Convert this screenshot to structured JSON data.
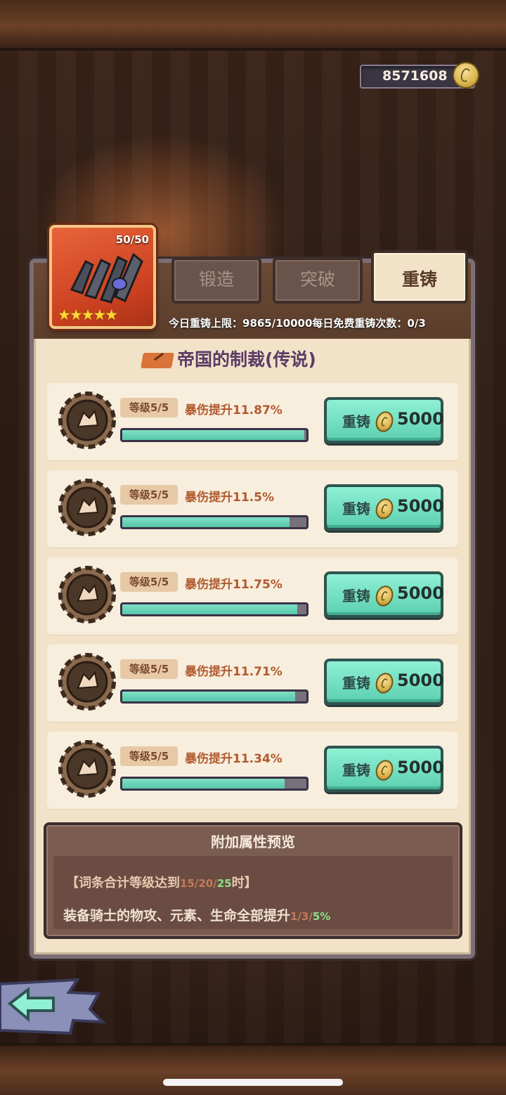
{
  "currency": {
    "amount": "8571608",
    "icon": "gold-coin-icon"
  },
  "item": {
    "level": "50/50",
    "stars": "★★★★★",
    "icon": "iron-claw-gauntlet-icon"
  },
  "tabs": [
    {
      "label": "锻造",
      "active": false
    },
    {
      "label": "突破",
      "active": false
    },
    {
      "label": "重铸",
      "active": true
    }
  ],
  "limits": {
    "text": "今日重铸上限：9865/10000每日免费重铸次数：0/3"
  },
  "set_title": "帝国的制裁(传说)",
  "affixes": [
    {
      "level": "等级5/5",
      "stat": "暴伤提升11.87%",
      "progress": 0.99,
      "button": "重铸",
      "cost": "5000"
    },
    {
      "level": "等级5/5",
      "stat": "暴伤提升11.5%",
      "progress": 0.91,
      "button": "重铸",
      "cost": "5000"
    },
    {
      "level": "等级5/5",
      "stat": "暴伤提升11.75%",
      "progress": 0.95,
      "button": "重铸",
      "cost": "5000"
    },
    {
      "level": "等级5/5",
      "stat": "暴伤提升11.71%",
      "progress": 0.94,
      "button": "重铸",
      "cost": "5000"
    },
    {
      "level": "等级5/5",
      "stat": "暴伤提升11.34%",
      "progress": 0.88,
      "button": "重铸",
      "cost": "5000"
    }
  ],
  "preview": {
    "title": "附加属性预览",
    "line1_prefix": "【词条合计等级达到",
    "line1_values_dim": "15/20/",
    "line1_values_green": "25",
    "line1_suffix": "时】",
    "line2_prefix": "装备骑士的物攻、元素、生命全部提升",
    "line2_values_dim": "1/3/",
    "line2_values_green": "5%"
  },
  "back_button": {
    "icon": "back-arrow-icon"
  },
  "colors": {
    "accent_green": "#5cd0b1",
    "panel": "#f2e3c8",
    "item_frame": "#c9401f"
  }
}
